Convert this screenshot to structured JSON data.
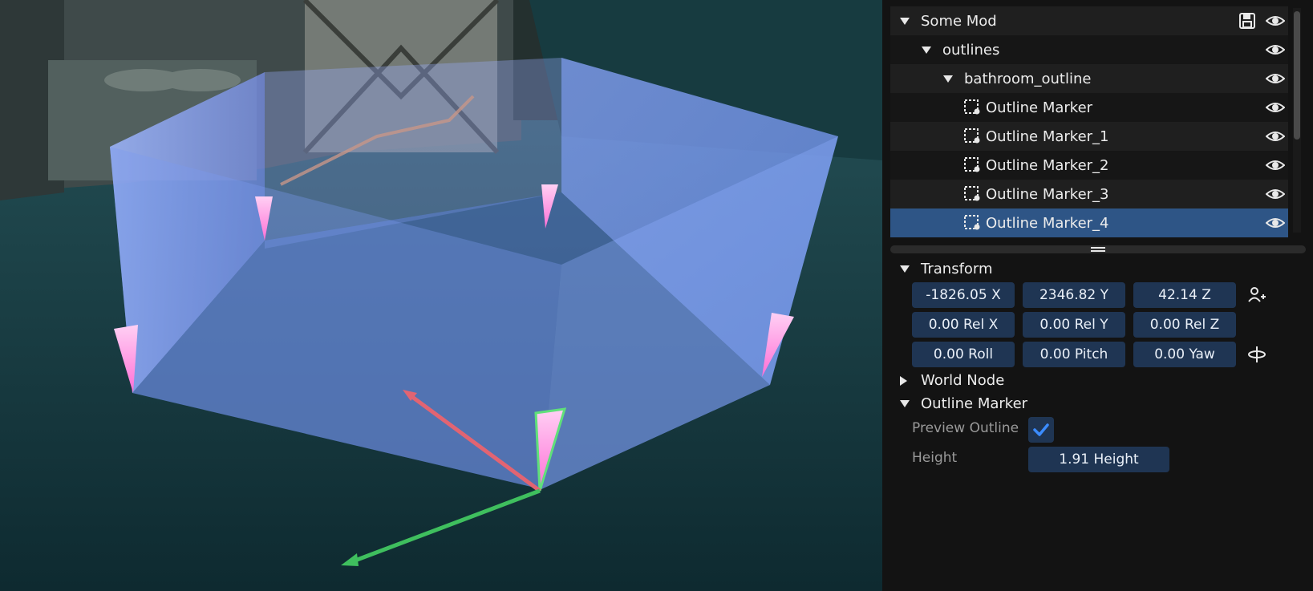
{
  "tree": {
    "items": [
      {
        "label": "Some Mod",
        "depth": 0,
        "expanded": true,
        "save": true
      },
      {
        "label": "outlines",
        "depth": 1,
        "expanded": true
      },
      {
        "label": "bathroom_outline",
        "depth": 2,
        "expanded": true
      },
      {
        "label": "Outline Marker",
        "depth": 3,
        "marker": true
      },
      {
        "label": "Outline Marker_1",
        "depth": 3,
        "marker": true
      },
      {
        "label": "Outline Marker_2",
        "depth": 3,
        "marker": true
      },
      {
        "label": "Outline Marker_3",
        "depth": 3,
        "marker": true
      },
      {
        "label": "Outline Marker_4",
        "depth": 3,
        "marker": true,
        "selected": true
      }
    ]
  },
  "sections": {
    "transform": "Transform",
    "world_node": "World Node",
    "outline_marker": "Outline Marker"
  },
  "transform": {
    "x": "-1826.05 X",
    "y": "2346.82 Y",
    "z": "42.14 Z",
    "rel_x": "0.00 Rel X",
    "rel_y": "0.00 Rel Y",
    "rel_z": "0.00 Rel Z",
    "roll": "0.00 Roll",
    "pitch": "0.00 Pitch",
    "yaw": "0.00 Yaw"
  },
  "outline_marker": {
    "preview_label": "Preview Outline",
    "preview_checked": true,
    "height_label": "Height",
    "height_value": "1.91 Height"
  },
  "colors": {
    "selected_row": "#2e5586",
    "field_bg": "#1f3553",
    "check_accent": "#3b8cff",
    "outline_volume": "#7aa2ff",
    "marker_pink": "#ff9ee6",
    "gizmo_x": "#e26472",
    "gizmo_y": "#3fbf5e"
  },
  "icons": {
    "visibility": "eye-icon",
    "save": "save-icon",
    "marker": "outline-marker-icon",
    "player_position": "person-plus-icon",
    "rotation": "rotation-axis-icon"
  }
}
